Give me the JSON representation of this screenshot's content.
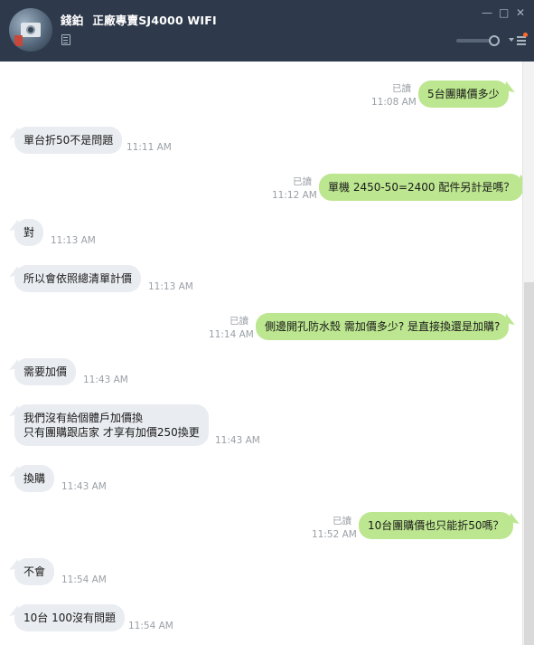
{
  "header": {
    "contact_name": "錢鉑",
    "contact_status": "正廠專賣SJ4000 WIFI",
    "colors": {
      "header_bg": "#2e3a4b",
      "icon": "#aab4c1",
      "notify_dot": "#ff6b2a"
    },
    "icons": {
      "minimize": "minimize-icon",
      "maximize": "maximize-icon",
      "close": "close-icon",
      "memo": "memo-icon",
      "menu": "menu-icon"
    },
    "glyphs": {
      "minimize": "—",
      "maximize": "□",
      "close": "✕"
    }
  },
  "chat": {
    "colors": {
      "incoming_bubble": "#e9ecf0",
      "outgoing_bubble": "#bce68f",
      "meta_text": "#9aa0a6"
    },
    "messages": [
      {
        "dir": "out",
        "text": [
          "5台團購價多少"
        ],
        "time": "11:08 AM",
        "read": "已讀"
      },
      {
        "dir": "in",
        "text": [
          "單台折50不是問題"
        ],
        "time": "11:11 AM"
      },
      {
        "dir": "out",
        "text": [
          "單機 2450-50=2400 配件另計是嗎？"
        ],
        "time": "11:12 AM",
        "read": "已讀"
      },
      {
        "dir": "in",
        "text": [
          "對"
        ],
        "time": "11:13 AM"
      },
      {
        "dir": "in",
        "text": [
          "所以會依照總清單計價"
        ],
        "time": "11:13 AM"
      },
      {
        "dir": "out",
        "text": [
          "側邊開孔防水殼 需加價多少? 是直接換還是加購?"
        ],
        "time": "11:14 AM",
        "read": "已讀"
      },
      {
        "dir": "in",
        "text": [
          "需要加價"
        ],
        "time": "11:43 AM"
      },
      {
        "dir": "in",
        "text": [
          "我們沒有給個體戶加價換",
          "只有團購跟店家  才享有加價250換更"
        ],
        "time": "11:43 AM"
      },
      {
        "dir": "in",
        "text": [
          "換購"
        ],
        "time": "11:43 AM"
      },
      {
        "dir": "out",
        "text": [
          "10台團購價也只能折50嗎？"
        ],
        "time": "11:52 AM",
        "read": "已讀"
      },
      {
        "dir": "in",
        "text": [
          "不會"
        ],
        "time": "11:54 AM"
      },
      {
        "dir": "in",
        "text": [
          "10台   100沒有問題"
        ],
        "time": "11:54 AM"
      }
    ]
  }
}
